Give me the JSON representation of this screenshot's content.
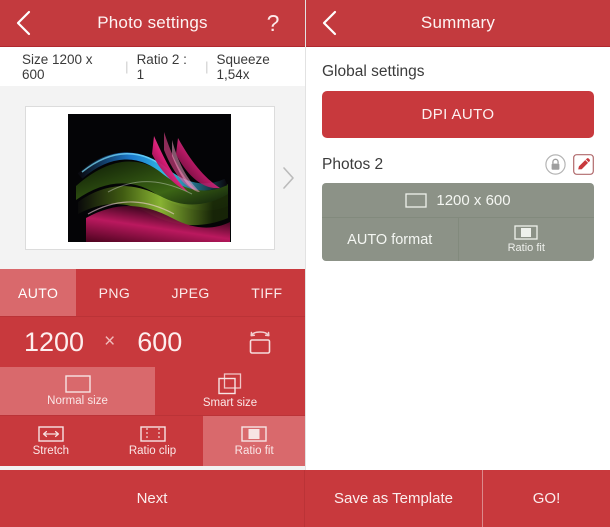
{
  "left": {
    "header": {
      "title": "Photo settings",
      "back_icon": "chevron-left-icon",
      "help_label": "?"
    },
    "info": {
      "size": "Size 1200 x 600",
      "ratio": "Ratio 2 : 1",
      "squeeze": "Squeeze 1,54x",
      "separator": "|"
    },
    "preview": {
      "next_icon": "chevron-right-icon"
    },
    "format_tabs": [
      {
        "label": "AUTO",
        "selected": true
      },
      {
        "label": "PNG",
        "selected": false
      },
      {
        "label": "JPEG",
        "selected": false
      },
      {
        "label": "TIFF",
        "selected": false
      }
    ],
    "dimensions": {
      "width": "1200",
      "times": "×",
      "height": "600",
      "swap_icon": "rotate-orientation-icon"
    },
    "size_modes_row1": [
      {
        "label": "Normal size",
        "icon": "rectangle-icon",
        "selected": true
      },
      {
        "label": "Smart size",
        "icon": "stacked-squares-icon",
        "selected": false
      }
    ],
    "size_modes_row2": [
      {
        "label": "Stretch",
        "icon": "horizontal-arrow-rect-icon",
        "selected": false
      },
      {
        "label": "Ratio clip",
        "icon": "dashed-crop-rect-icon",
        "selected": false
      },
      {
        "label": "Ratio fit",
        "icon": "fit-rect-icon",
        "selected": true
      }
    ]
  },
  "right": {
    "header": {
      "title": "Summary",
      "back_icon": "chevron-left-icon"
    },
    "global_settings_title": "Global settings",
    "dpi_button": "DPI AUTO",
    "photos_label": "Photos 2",
    "lock_icon": "lock-icon",
    "edit_icon": "pencil-edit-icon",
    "photo_card": {
      "size_label": "1200 x 600",
      "size_icon": "rectangle-icon",
      "format_label": "AUTO format",
      "fit_label": "Ratio fit",
      "fit_icon": "fit-rect-icon"
    }
  },
  "bottom": {
    "next": "Next",
    "save_as_template": "Save as Template",
    "go": "GO!"
  },
  "colors": {
    "accent_red": "#c8393d",
    "header_red": "#c33a3e",
    "selected_red": "#d9696c",
    "card_gray": "#8c9287",
    "page_gray": "#f3f3f3"
  }
}
